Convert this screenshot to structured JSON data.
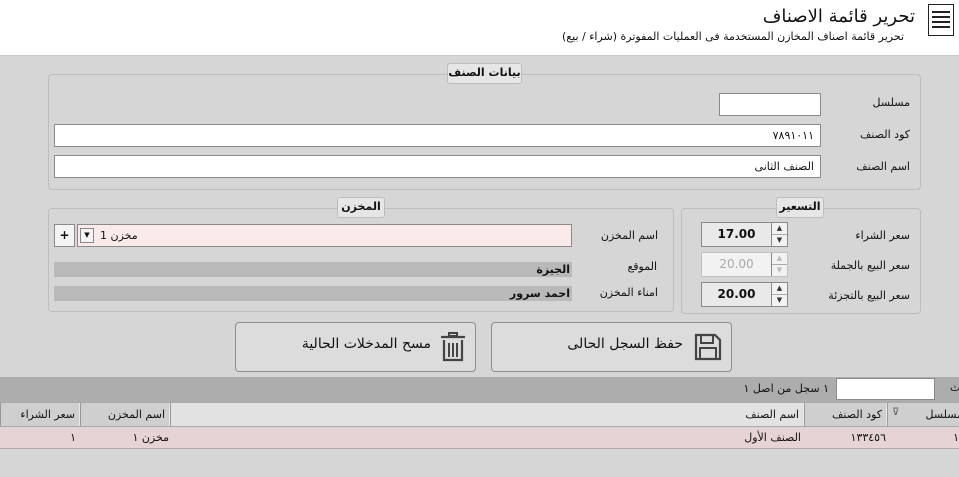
{
  "header": {
    "title": "تحرير قائمة الاصناف",
    "subtitle": "تحرير قائمة اصناف المخازن المستخدمة فى العمليات المفوترة (شراء / بيع)",
    "icon": "list-document-icon"
  },
  "item_data": {
    "legend": "بيانات الصنف",
    "serial_label": "مسلسل",
    "serial_value": "",
    "code_label": "كود الصنف",
    "code_value": "٧٨٩١٠١١",
    "name_label": "اسم الصنف",
    "name_value": "الصنف الثانى"
  },
  "warehouse": {
    "legend": "المخزن",
    "name_label": "اسم المخزن",
    "selected_warehouse": "مخزن 1",
    "add_label": "+",
    "dropdown_icon": "chevron-down-icon",
    "location_label": "الموقع",
    "location_value": "الجيزة",
    "keeper_label": "امناء المخزن",
    "keeper_value": "احمد سرور"
  },
  "pricing": {
    "legend": "التسعير",
    "purchase_label": "سعر الشراء",
    "purchase_value": "17.00",
    "wholesale_label": "سعر البيع بالجملة",
    "wholesale_value": "20.00",
    "retail_label": "سعر البيع بالتجزئة",
    "retail_value": "20.00"
  },
  "actions": {
    "save_label": "حفظ السجل الحالى",
    "save_icon": "floppy-disk-icon",
    "clear_label": "مسح المدخلات الحالية",
    "clear_icon": "trash-icon"
  },
  "search": {
    "label": "بحث",
    "value": "",
    "record_count": "١ سجل من اصل ١"
  },
  "table": {
    "columns": [
      "مسلسل",
      "كود الصنف",
      "اسم الصنف",
      "اسم المخزن",
      "سعر الشراء"
    ],
    "rows": [
      {
        "serial": "١",
        "code": "١٣٣٤٥٦",
        "name": "الصنف الأول",
        "warehouse": "مخزن ١",
        "purchase_price": "١"
      }
    ]
  }
}
